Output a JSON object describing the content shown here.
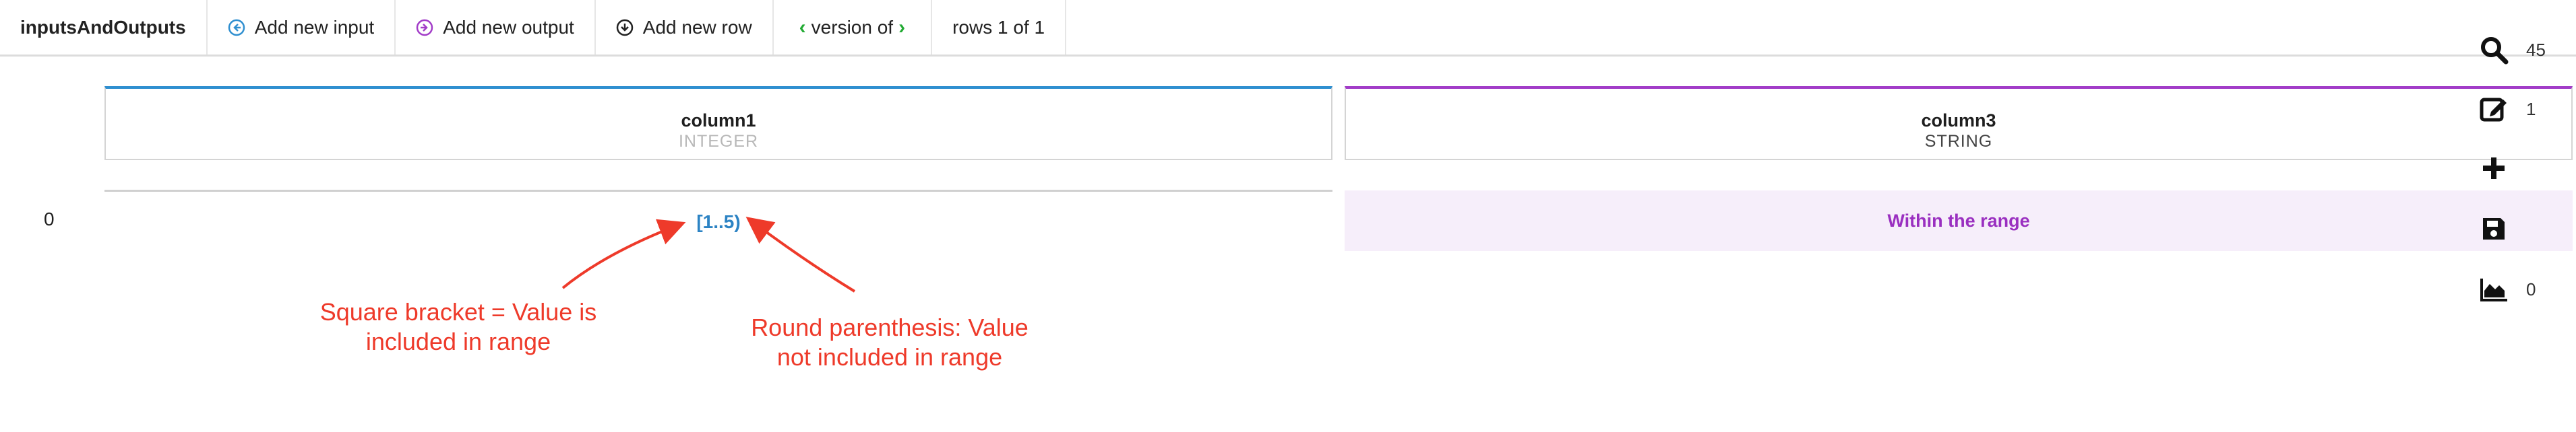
{
  "toolbar": {
    "title": "inputsAndOutputs",
    "add_input": "Add new input",
    "add_output": "Add new output",
    "add_row": "Add new row",
    "version_label": "version of",
    "rows_label": "rows 1 of 1"
  },
  "columns": [
    {
      "name": "column1",
      "type": "INTEGER",
      "accent": "#2f8fd0"
    },
    {
      "name": "column3",
      "type": "STRING",
      "accent": "#a23cc8"
    }
  ],
  "rows": [
    {
      "index": "0",
      "column1": "[1..5)",
      "column3": "Within the range"
    }
  ],
  "annotations": {
    "left": [
      "Square bracket = Value is",
      "included in range"
    ],
    "right": [
      "Round parenthesis: Value",
      "not included in range"
    ],
    "color": "#ee3a2a"
  },
  "sidebar": {
    "search_count": "45",
    "edit_count": "1",
    "chart_count": "0",
    "icons": [
      "search-icon",
      "edit-icon",
      "plus-icon",
      "save-icon",
      "area-chart-icon"
    ]
  }
}
